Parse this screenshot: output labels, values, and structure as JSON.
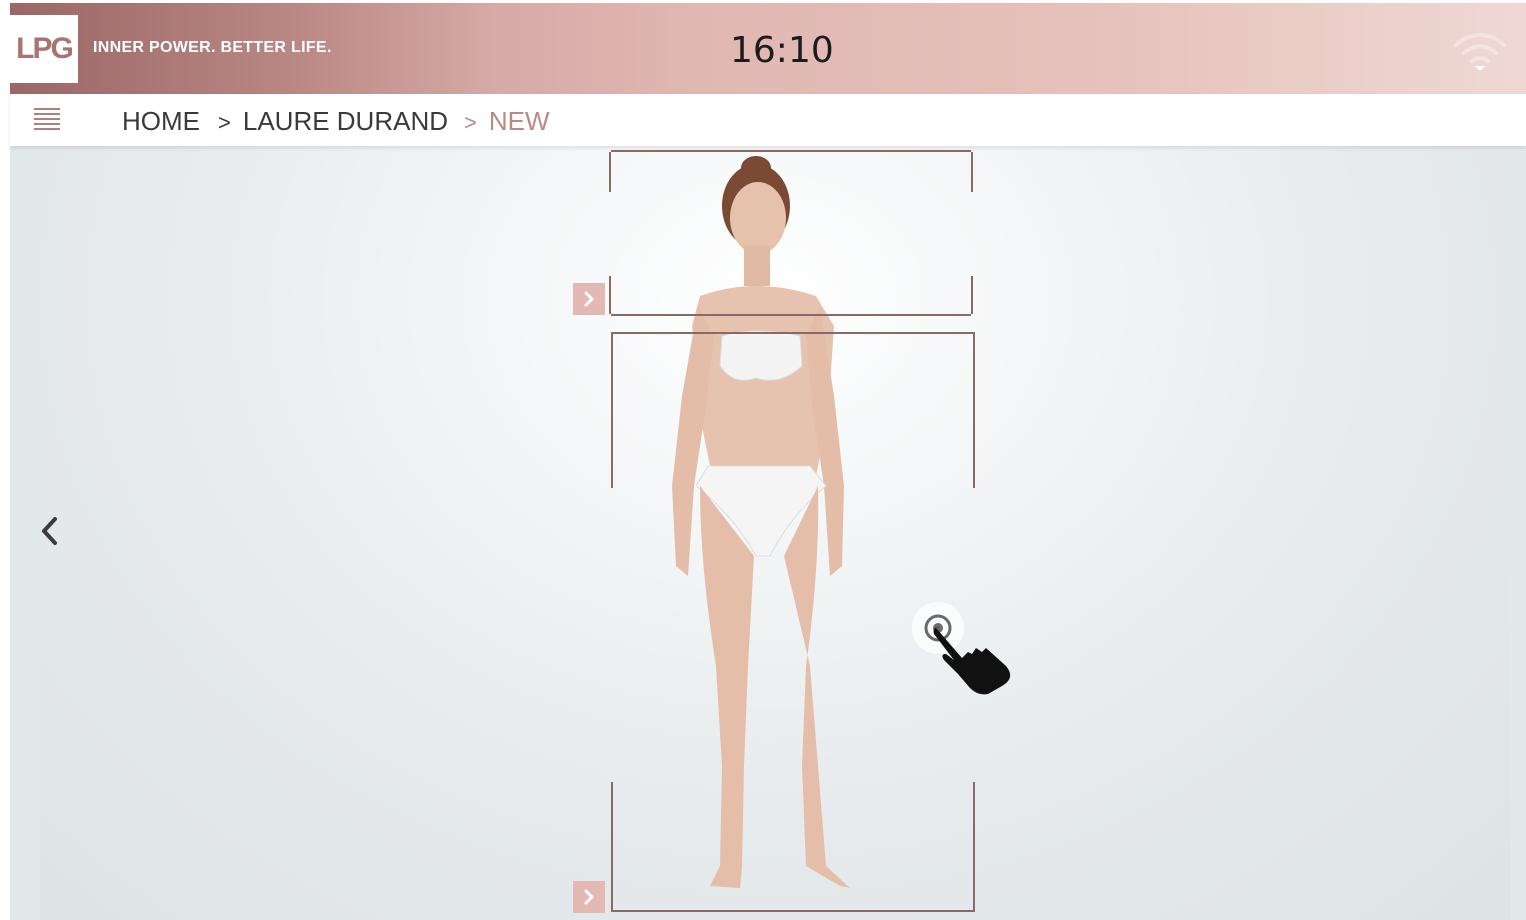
{
  "header": {
    "logo_text": "LPG",
    "tagline": "INNER POWER. BETTER LIFE.",
    "clock": "16:10",
    "wifi_icon": "wifi-icon",
    "brand_color": "#a77471"
  },
  "nav": {
    "menu_icon": "hamburger-menu-icon",
    "breadcrumb": {
      "home": "HOME",
      "sep": ">",
      "client": "LAURE DURAND",
      "current": "NEW"
    }
  },
  "viewer": {
    "back_icon": "chevron-left-icon",
    "zone_arrow_icon": "chevron-right-icon",
    "tap_hint_icon": "tap-hand-icon",
    "accent_color": "#e4b8b3"
  }
}
